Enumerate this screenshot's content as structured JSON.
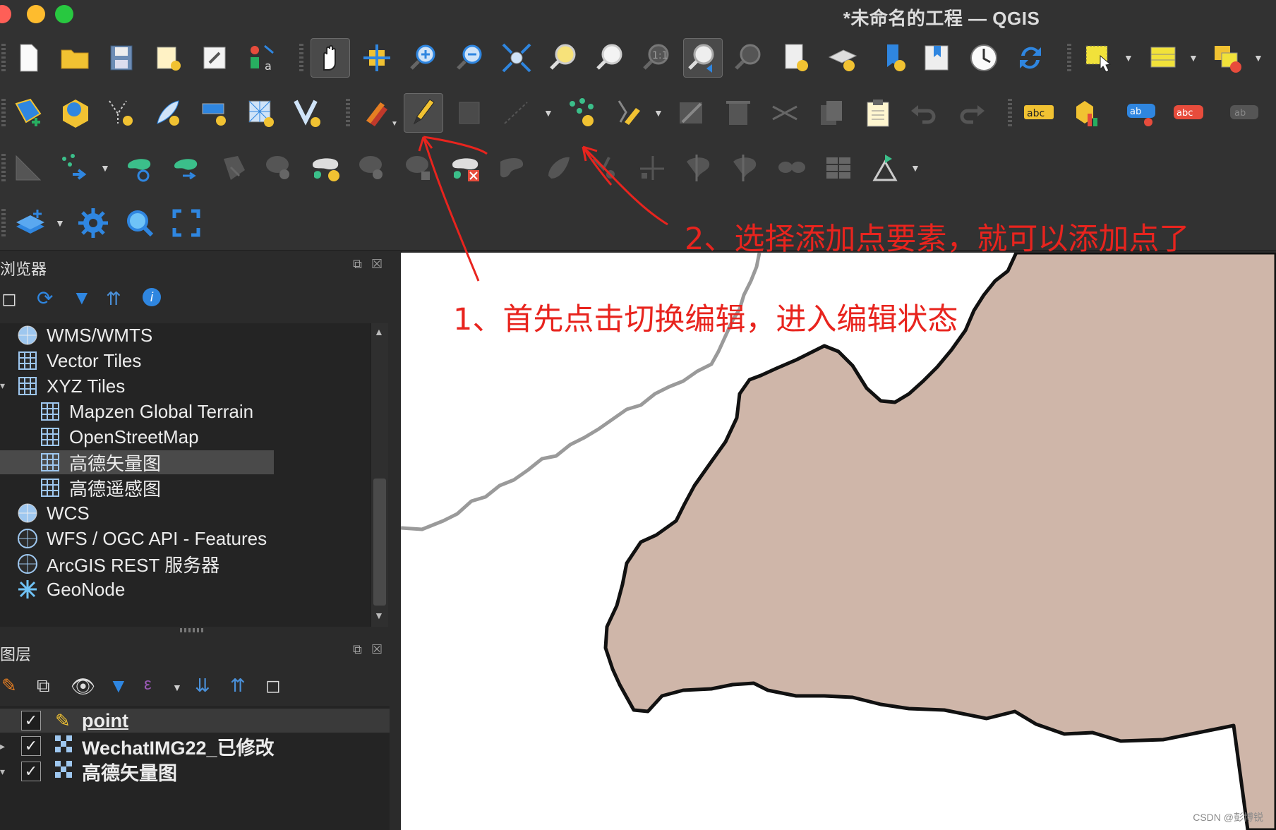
{
  "window": {
    "title": "*未命名的工程 — QGIS"
  },
  "toolbar1": [
    "new-project",
    "open-project",
    "save-project",
    "new-print-layout",
    "layout-manager",
    "style-manager",
    "pan-map",
    "pan-to-selection",
    "zoom-in",
    "zoom-out",
    "zoom-full",
    "zoom-to-selection",
    "zoom-to-layer",
    "zoom-native",
    "zoom-last",
    "zoom-next",
    "new-map-view",
    "new-3d-map-view",
    "new-bookmark",
    "show-bookmarks",
    "temporal-controller",
    "refresh",
    "select-features",
    "open-attribute-table",
    "deselect-all"
  ],
  "toolbar2": [
    "data-source-manager",
    "new-geopackage-layer",
    "new-shapefile-layer",
    "new-spatialite-layer",
    "new-virtual-layer",
    "new-mesh-layer",
    "new-gps-layer",
    "current-edits",
    "toggle-editing",
    "save-layer-edits",
    "digitize-line",
    "add-point-feature",
    "vertex-tool",
    "modify-attributes",
    "delete-selected",
    "cut-features",
    "copy-features",
    "paste-features",
    "undo",
    "redo",
    "label-tool",
    "diagram-tool",
    "pin-labels",
    "show-labels",
    "move-label"
  ],
  "browser": {
    "title": "浏览器",
    "items": [
      {
        "label": "WMS/WMTS",
        "indent": 0
      },
      {
        "label": "Vector Tiles",
        "indent": 0
      },
      {
        "label": "XYZ Tiles",
        "indent": 0
      },
      {
        "label": "Mapzen Global Terrain",
        "indent": 1
      },
      {
        "label": "OpenStreetMap",
        "indent": 1
      },
      {
        "label": "高德矢量图",
        "indent": 1
      },
      {
        "label": "高德遥感图",
        "indent": 1
      },
      {
        "label": "WCS",
        "indent": 0
      },
      {
        "label": "WFS / OGC API - Features",
        "indent": 0
      },
      {
        "label": "ArcGIS REST 服务器",
        "indent": 0
      },
      {
        "label": "GeoNode",
        "indent": 0
      }
    ],
    "selected_index": 5
  },
  "layers": {
    "title": "图层",
    "items": [
      {
        "label": "point",
        "checked": true
      },
      {
        "label": "WechatIMG22_已修改",
        "checked": true
      },
      {
        "label": "高德矢量图",
        "checked": true
      }
    ]
  },
  "annotations": {
    "step1": "1、首先点击切换编辑，进入编辑状态",
    "step2": "2、选择添加点要素，就可以添加点了",
    "color": "#e8241e"
  },
  "watermark": "CSDN @彭博锐",
  "colors": {
    "map_fill": "#cfb6a9",
    "accent_blue": "#2f86e0",
    "highlight": "#4a4a4a"
  }
}
